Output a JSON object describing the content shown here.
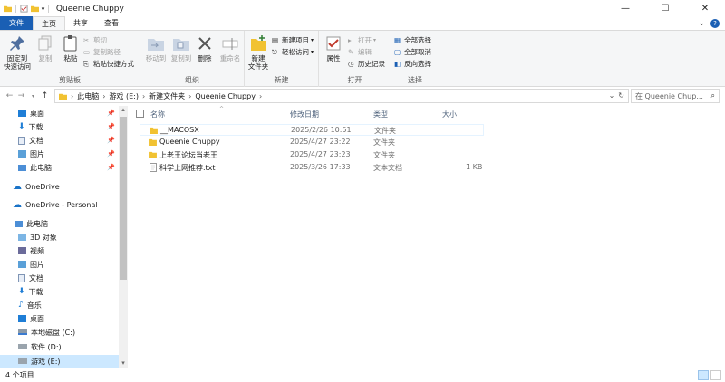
{
  "window": {
    "title": "Queenie Chuppy",
    "controls": {
      "minimize": "—",
      "maximize": "☐",
      "close": "✕"
    }
  },
  "ribbon_tabs": [
    "文件",
    "主页",
    "共享",
    "查看"
  ],
  "ribbon": {
    "clipboard": {
      "label": "剪贴板",
      "pin": "固定到\n快速访问",
      "copy": "复制",
      "paste": "粘贴",
      "cut": "剪切",
      "copy_path": "复制路径",
      "paste_shortcut": "粘贴快捷方式"
    },
    "organize": {
      "label": "组织",
      "move_to": "移动到",
      "copy_to": "复制到",
      "delete": "删除",
      "rename": "重命名"
    },
    "new": {
      "label": "新建",
      "new_folder": "新建\n文件夹",
      "new_item": "新建项目",
      "easy_access": "轻松访问"
    },
    "open": {
      "label": "打开",
      "properties": "属性",
      "open": "打开",
      "edit": "编辑",
      "history": "历史记录"
    },
    "select": {
      "label": "选择",
      "select_all": "全部选择",
      "select_none": "全部取消",
      "invert": "反向选择"
    }
  },
  "address": {
    "crumbs": [
      "此电脑",
      "游戏 (E:)",
      "新建文件夹",
      "Queenie Chuppy"
    ],
    "search_placeholder": "在 Queenie Chup..."
  },
  "nav": {
    "quick_access": [
      {
        "label": "桌面",
        "pinned": true
      },
      {
        "label": "下载",
        "pinned": true
      },
      {
        "label": "文档",
        "pinned": true
      },
      {
        "label": "图片",
        "pinned": true
      },
      {
        "label": "此电脑",
        "pinned": true
      }
    ],
    "onedrive": "OneDrive",
    "onedrive_personal": "OneDrive - Personal",
    "this_pc": "此电脑",
    "pc_items": [
      "3D 对象",
      "视频",
      "图片",
      "文档",
      "下载",
      "音乐",
      "桌面",
      "本地磁盘 (C:)",
      "软件 (D:)",
      "游戏 (E:)"
    ]
  },
  "columns": {
    "name": "名称",
    "modified": "修改日期",
    "type": "类型",
    "size": "大小"
  },
  "files": [
    {
      "name": "__MACOSX",
      "modified": "2025/2/26 10:51",
      "type": "文件夹",
      "size": "",
      "kind": "folder"
    },
    {
      "name": "Queenie Chuppy",
      "modified": "2025/4/27 23:22",
      "type": "文件夹",
      "size": "",
      "kind": "folder"
    },
    {
      "name": "上老王论坛当老王",
      "modified": "2025/4/27 23:23",
      "type": "文件夹",
      "size": "",
      "kind": "folder"
    },
    {
      "name": "科学上网推荐.txt",
      "modified": "2025/3/26 17:33",
      "type": "文本文档",
      "size": "1 KB",
      "kind": "text"
    }
  ],
  "status": {
    "item_count": "4 个项目"
  },
  "colors": {
    "accent": "#1a5fb4",
    "folder": "#f1c232",
    "selected": "#cce8ff"
  }
}
